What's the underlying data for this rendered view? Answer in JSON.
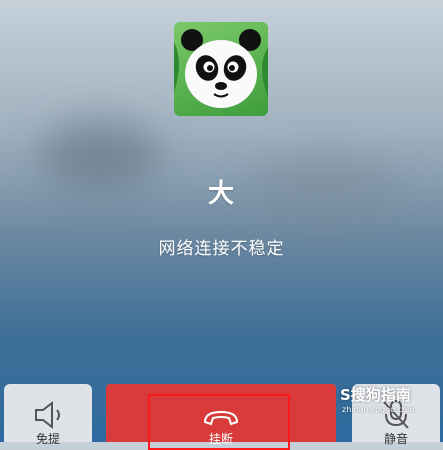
{
  "caller": {
    "name": "大",
    "status": "网络连接不稳定",
    "avatar_icon": "panda-avatar"
  },
  "controls": {
    "speaker": {
      "icon": "speaker-icon",
      "label": "免提"
    },
    "end_call": {
      "icon": "hang-up-icon",
      "label": "挂断",
      "color": "#d93b3b"
    },
    "mute": {
      "icon": "microphone-mute-icon",
      "label": "静音"
    }
  },
  "watermark": {
    "main": "S搜狗指南",
    "sub": "zhinan.sogou.com"
  }
}
